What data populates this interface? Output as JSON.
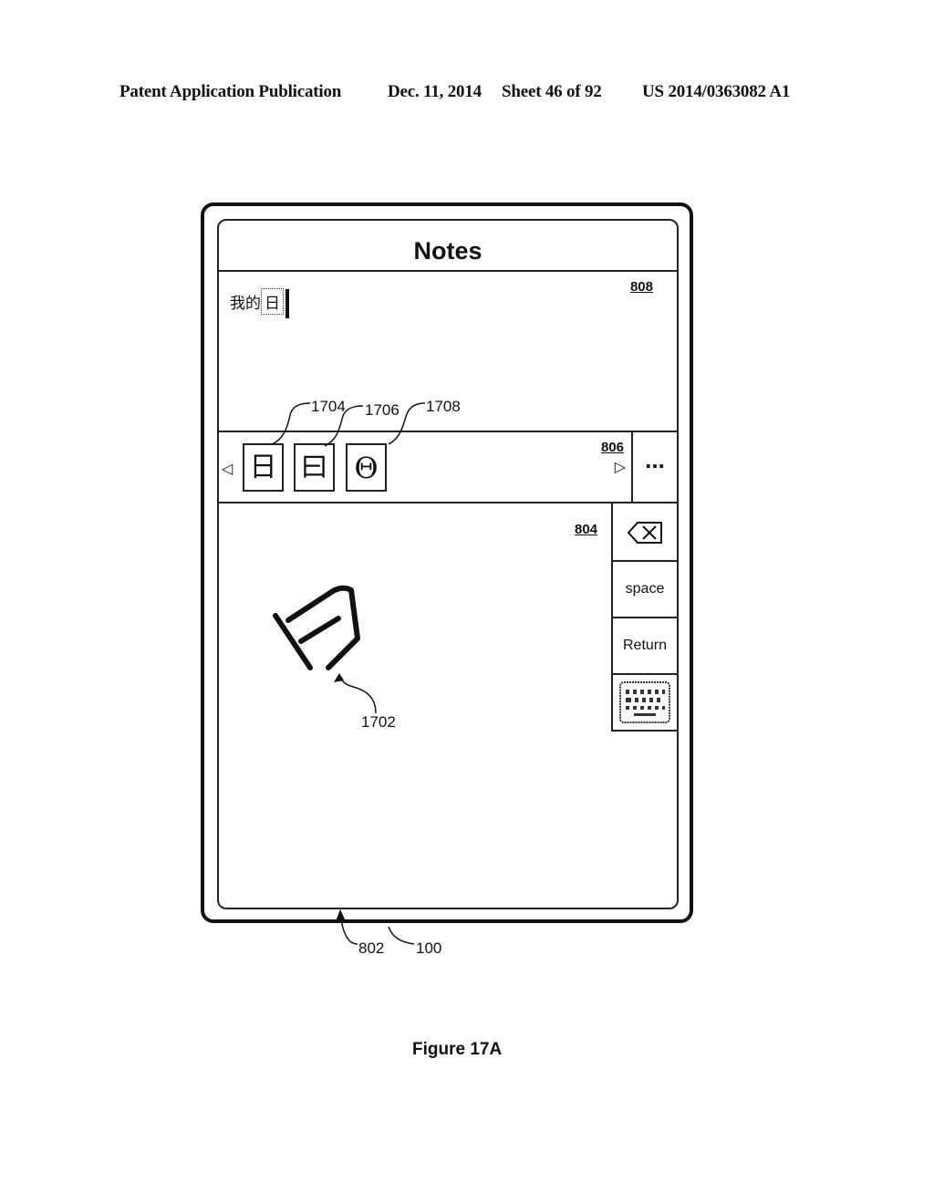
{
  "header": {
    "publication": "Patent Application Publication",
    "date": "Dec. 11, 2014",
    "sheet": "Sheet 46 of 92",
    "number": "US 2014/0363082 A1"
  },
  "app": {
    "title": "Notes",
    "text_area_ref": "808",
    "committed_text": "我的",
    "preedit_text": "日"
  },
  "candidate_bar": {
    "ref": "806",
    "candidates": [
      {
        "char": "日",
        "ref": "1704"
      },
      {
        "char": "曰",
        "ref": "1706"
      },
      {
        "char": "Θ",
        "ref": "1708"
      }
    ],
    "prev_icon": "triangle-left-icon",
    "next_icon": "triangle-right-icon",
    "more_label": "..."
  },
  "handwriting_area": {
    "ref": "804",
    "stroke_ref": "1702"
  },
  "side_keys": {
    "backspace_icon": "backspace-icon",
    "space_label": "space",
    "return_label": "Return",
    "keyboard_icon": "keyboard-icon"
  },
  "device_refs": {
    "screen": "802",
    "device": "100"
  },
  "figure_label": "Figure 17A"
}
